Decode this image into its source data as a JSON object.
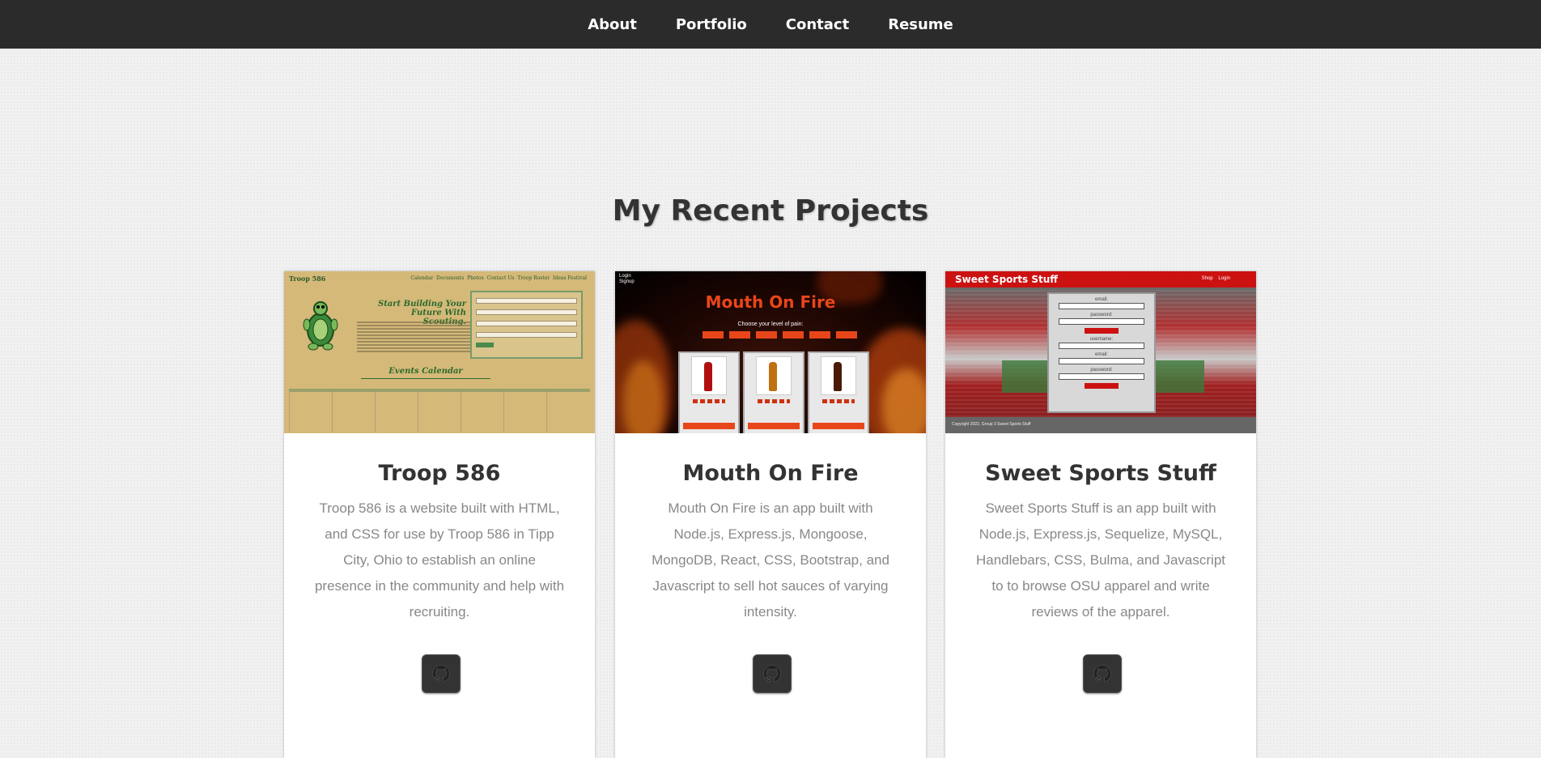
{
  "nav": {
    "items": [
      "About",
      "Portfolio",
      "Contact",
      "Resume"
    ]
  },
  "section": {
    "title": "My Recent Projects"
  },
  "projects": [
    {
      "title": "Troop 586",
      "description": "Troop 586 is a website built with HTML, and CSS for use by Troop 586 in Tipp City, Ohio to establish an online presence in the community and help with recruiting.",
      "link_icon": "github-icon",
      "thumbnail": {
        "brand": "Troop 586",
        "nav": [
          "Calendar",
          "Documents",
          "Photos",
          "Contact Us",
          "Troop Roster",
          "Ideas Festival"
        ],
        "headline": "Start Building Your Future With Scouting.",
        "section": "Events Calendar",
        "bg_color": "#d4b979"
      }
    },
    {
      "title": "Mouth On Fire",
      "description": "Mouth On Fire is an app built with Node.js, Express.js, Mongoose, MongoDB, React, CSS, Bootstrap, and Javascript to sell hot sauces of varying intensity.",
      "link_icon": "github-icon",
      "thumbnail": {
        "login": "Login",
        "signup": "Signup",
        "title": "Mouth On Fire",
        "subtitle": "Choose your level of pain:",
        "accent_color": "#e8461a"
      }
    },
    {
      "title": "Sweet Sports Stuff",
      "description": "Sweet Sports Stuff is an app built with Node.js, Express.js, Sequelize, MySQL, Handlebars, CSS, Bulma, and Javascript to to browse OSU apparel and write reviews of the apparel.",
      "link_icon": "github-icon",
      "thumbnail": {
        "brand": "Sweet Sports Stuff",
        "links": [
          "Shop",
          "Login"
        ],
        "form_labels": [
          "email:",
          "password:",
          "username:",
          "email:",
          "password:"
        ],
        "footer": "Copyright 2022, Group 3 Sweet Sports Stuff",
        "accent_color": "#cc1111"
      }
    }
  ],
  "colors": {
    "navbar_bg": "#2b2b2b",
    "page_bg": "#f1f1f1",
    "button_bg": "#333333"
  }
}
